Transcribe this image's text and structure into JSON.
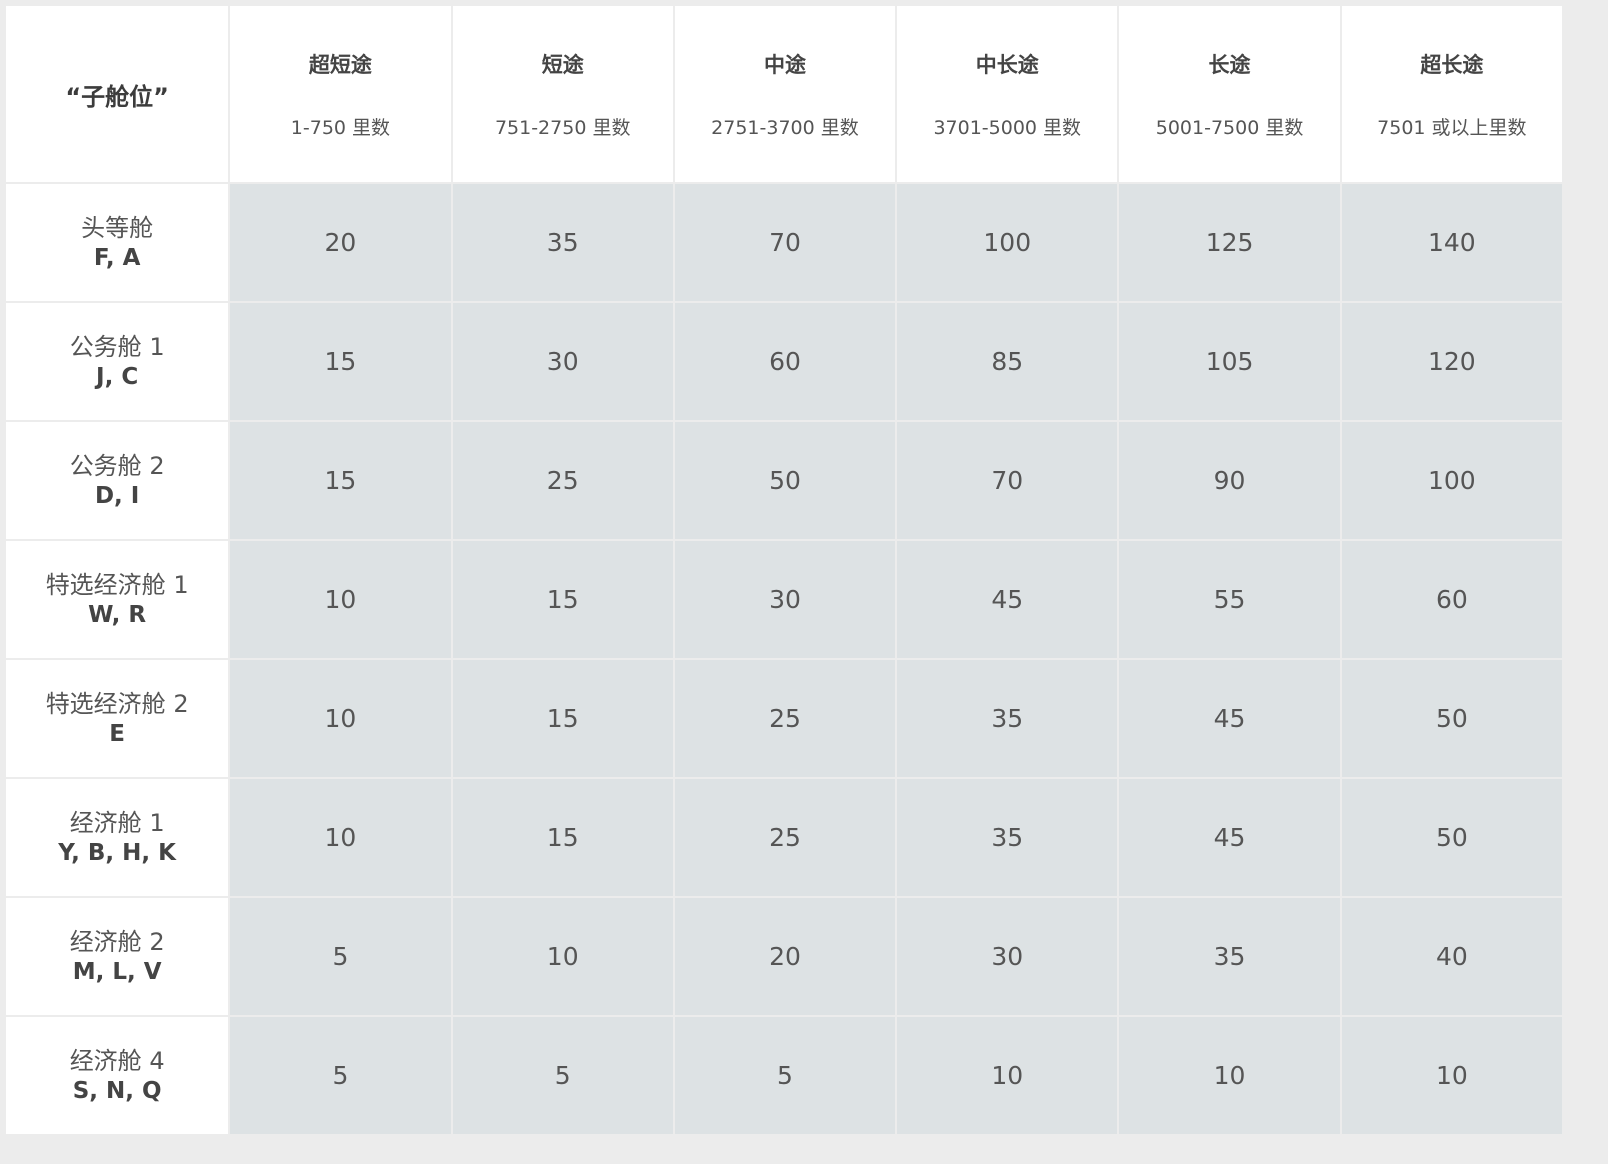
{
  "table": {
    "corner_label": "“子舱位”",
    "bands": [
      {
        "name": "超短途",
        "range": "1-750 里数"
      },
      {
        "name": "短途",
        "range": "751-2750 里数"
      },
      {
        "name": "中途",
        "range": "2751-3700 里数"
      },
      {
        "name": "中长途",
        "range": "3701-5000 里数"
      },
      {
        "name": "长途",
        "range": "5001-7500 里数"
      },
      {
        "name": "超长途",
        "range": "7501 或以上里数"
      }
    ],
    "rows": [
      {
        "cabin": "头等舱",
        "codes": "F, A",
        "values": [
          "20",
          "35",
          "70",
          "100",
          "125",
          "140"
        ]
      },
      {
        "cabin": "公务舱 1",
        "codes": "J, C",
        "values": [
          "15",
          "30",
          "60",
          "85",
          "105",
          "120"
        ]
      },
      {
        "cabin": "公务舱 2",
        "codes": "D, I",
        "values": [
          "15",
          "25",
          "50",
          "70",
          "90",
          "100"
        ]
      },
      {
        "cabin": "特选经济舱 1",
        "codes": "W, R",
        "values": [
          "10",
          "15",
          "30",
          "45",
          "55",
          "60"
        ]
      },
      {
        "cabin": "特选经济舱 2",
        "codes": "E",
        "values": [
          "10",
          "15",
          "25",
          "35",
          "45",
          "50"
        ]
      },
      {
        "cabin": "经济舱 1",
        "codes": "Y, B, H, K",
        "values": [
          "10",
          "15",
          "25",
          "35",
          "45",
          "50"
        ]
      },
      {
        "cabin": "经济舱 2",
        "codes": "M, L, V",
        "values": [
          "5",
          "10",
          "20",
          "30",
          "35",
          "40"
        ]
      },
      {
        "cabin": "经济舱 4",
        "codes": "S, N, Q",
        "values": [
          "5",
          "5",
          "5",
          "10",
          "10",
          "10"
        ]
      }
    ]
  }
}
